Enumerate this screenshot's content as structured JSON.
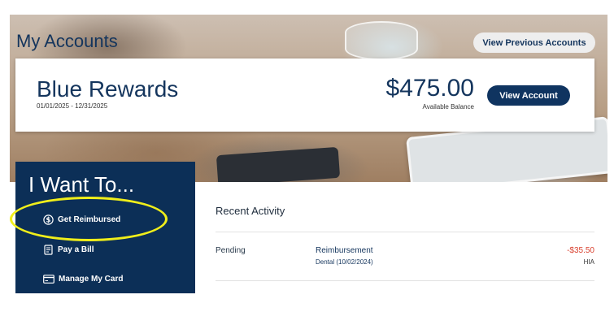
{
  "header": {
    "title": "My Accounts",
    "view_previous_label": "View Previous Accounts"
  },
  "account": {
    "name": "Blue Rewards",
    "dates": "01/01/2025 - 12/31/2025",
    "balance": "$475.00",
    "balance_label": "Available Balance",
    "view_account_label": "View Account"
  },
  "i_want_to": {
    "title": "I Want To...",
    "items": [
      {
        "label": "Get Reimbursed",
        "icon": "dollar-circle-icon"
      },
      {
        "label": "Pay a Bill",
        "icon": "bill-icon"
      },
      {
        "label": "Manage My Card",
        "icon": "card-icon"
      }
    ]
  },
  "recent_activity": {
    "title": "Recent Activity",
    "rows": [
      {
        "status": "Pending",
        "type": "Reimbursement",
        "detail": "Dental (10/02/2024)",
        "amount": "-$35.50",
        "account": "HIA"
      }
    ]
  },
  "colors": {
    "brand_navy": "#0c2f57",
    "negative_amount": "#d9412f",
    "highlight": "#f0ee1a"
  }
}
